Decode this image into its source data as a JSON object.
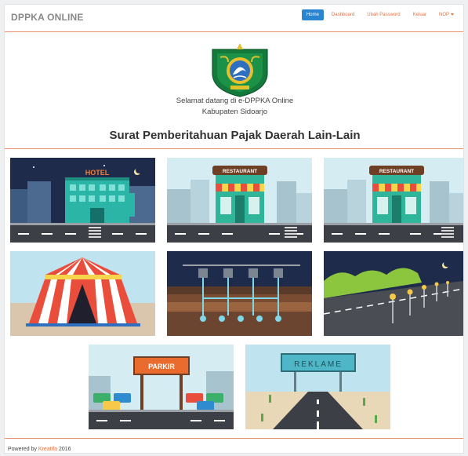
{
  "app": {
    "brand": "DPPKA ONLINE"
  },
  "nav": {
    "items": [
      {
        "label": "Home"
      },
      {
        "label": "Dashboard"
      },
      {
        "label": "Ubah Password"
      },
      {
        "label": "Keluar"
      },
      {
        "label": "NOP"
      }
    ],
    "active": "Home"
  },
  "welcome": {
    "line1": "Selamat datang di e-DPPKA Online",
    "line2": "Kabupaten Sidoarjo"
  },
  "main": {
    "title": "Surat Pemberitahuan Pajak Daerah Lain-Lain"
  },
  "tiles": {
    "hotel_sign": "HOTEL",
    "restaurant_sign": "RESTAURANT",
    "parkir_sign": "PARKIR",
    "reklame_sign": "REKLAME"
  },
  "footer": {
    "prefix": "Powered by",
    "link": "Kreatifa",
    "year": "2016"
  },
  "colors": {
    "accent": "#e4713f",
    "primary": "#2a85d0",
    "divider": "#e9906e"
  }
}
